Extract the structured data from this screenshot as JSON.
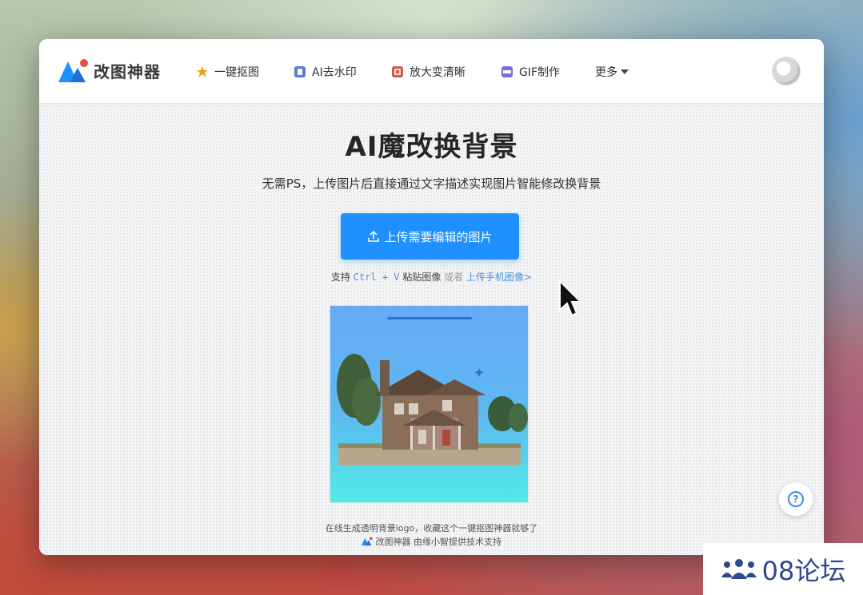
{
  "app": {
    "logo_text": "改图神器",
    "brand_color": "#1e90ff"
  },
  "nav": {
    "items": [
      {
        "label": "一键抠图",
        "icon": "cutout-star-icon"
      },
      {
        "label": "AI去水印",
        "icon": "watermark-remove-icon"
      },
      {
        "label": "放大变清晰",
        "icon": "upscale-icon"
      },
      {
        "label": "GIF制作",
        "icon": "gif-icon"
      },
      {
        "label": "更多",
        "icon": "chevron-down-icon"
      }
    ]
  },
  "main": {
    "title": "AI魔改换背景",
    "subtitle": "无需PS，上传图片后直接通过文字描述实现图片智能修改换背景",
    "upload_button": "上传需要编辑的图片",
    "hint_prefix": "支持",
    "hint_shortcut": "Ctrl + V",
    "hint_paste": "粘贴图像",
    "hint_or": "或者",
    "hint_mobile_link": "上传手机图像>"
  },
  "footer": {
    "line1": "在线生成透明背景logo，收藏这个一键抠图神器就够了",
    "line2": "改图神器 由缘小智提供技术支持"
  },
  "watermark": {
    "text": "08论坛"
  }
}
